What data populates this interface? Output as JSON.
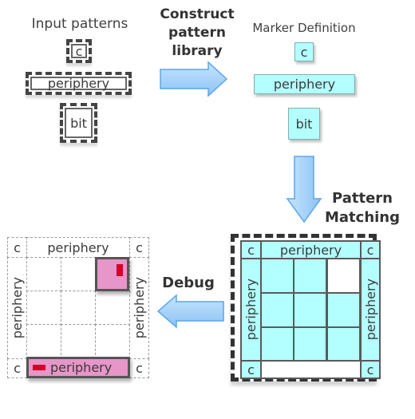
{
  "input_patterns": {
    "title": "Input patterns",
    "items": [
      "c",
      "periphery",
      "bit"
    ]
  },
  "construct_step": {
    "label_lines": [
      "Construct",
      "pattern",
      "library"
    ],
    "arrow_direction": "right"
  },
  "marker_definition": {
    "title": "Marker Definition",
    "items": [
      "c",
      "periphery",
      "bit"
    ]
  },
  "pattern_matching_step": {
    "label_lines": [
      "Pattern",
      "Matching"
    ],
    "arrow_direction": "down"
  },
  "matched_array": {
    "corner_label": "c",
    "top_label": "periphery",
    "left_label": "periphery",
    "right_label": "periphery",
    "bottom_label": "",
    "bottom_matched": false,
    "bit_matched": [
      [
        true,
        true,
        false
      ],
      [
        true,
        true,
        true
      ],
      [
        true,
        true,
        true
      ]
    ]
  },
  "debug_step": {
    "label": "Debug",
    "arrow_direction": "left"
  },
  "debug_view": {
    "corner_label": "c",
    "top_label": "periphery",
    "left_label": "periphery",
    "right_label": "periphery",
    "bottom_label": "periphery",
    "flagged": [
      "bit row 1 col 3",
      "bottom periphery"
    ]
  },
  "colors": {
    "matched_fill": "#b3ffff",
    "error_highlight": "#e696c8",
    "error_marker": "#d4002a",
    "arrow_fill": "#a9d4fb"
  }
}
